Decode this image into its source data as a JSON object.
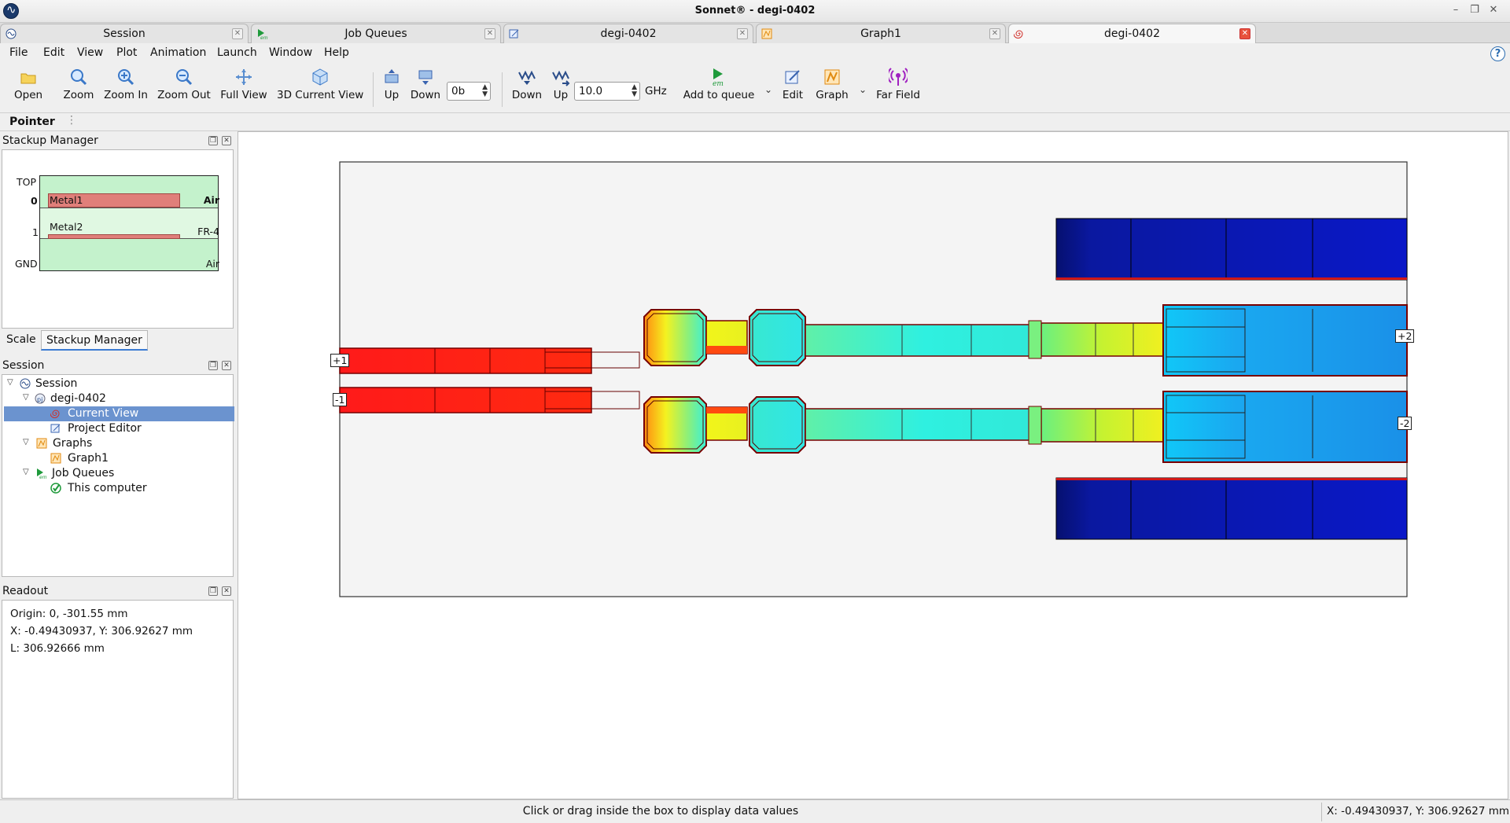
{
  "window": {
    "title": "Sonnet® - degi-0402"
  },
  "doc_tabs": [
    {
      "label": "Session",
      "icon": "sonnet-session-icon"
    },
    {
      "label": "Job Queues",
      "icon": "em-queue-icon"
    },
    {
      "label": "degi-0402",
      "icon": "project-editor-icon"
    },
    {
      "label": "Graph1",
      "icon": "graph-icon"
    },
    {
      "label": "degi-0402",
      "icon": "current-view-spiral-icon",
      "active": true
    }
  ],
  "menu": [
    "File",
    "Edit",
    "View",
    "Plot",
    "Animation",
    "Launch",
    "Window",
    "Help"
  ],
  "toolbar": {
    "open": "Open",
    "zoom": "Zoom",
    "zoom_in": "Zoom In",
    "zoom_out": "Zoom Out",
    "full_view": "Full View",
    "view_3d": "3D Current View",
    "level_up": "Up",
    "level_down": "Down",
    "level_value": "0b",
    "freq_down": "Down",
    "freq_up": "Up",
    "freq_value": "10.0",
    "freq_unit": "GHz",
    "add_to_queue": "Add to queue",
    "edit": "Edit",
    "graph": "Graph",
    "far_field": "Far Field"
  },
  "mode": {
    "label": "Pointer"
  },
  "stackup": {
    "title": "Stackup Manager",
    "labels": {
      "top": "TOP",
      "level0": "0",
      "level1": "1",
      "gnd": "GND"
    },
    "metals": [
      "Metal1",
      "Metal2"
    ],
    "dielectrics": [
      "Air",
      "FR-4",
      "Air"
    ]
  },
  "scale_tabs": [
    "Scale",
    "Stackup Manager"
  ],
  "session": {
    "title": "Session",
    "tree": [
      {
        "label": "Session",
        "icon": "sonnet-session-icon",
        "level": 0,
        "expanded": true
      },
      {
        "label": "degi-0402",
        "icon": "project-icon",
        "level": 1,
        "expanded": true
      },
      {
        "label": "Current View",
        "icon": "current-view-spiral-icon",
        "level": 2,
        "selected": true
      },
      {
        "label": "Project Editor",
        "icon": "project-editor-icon",
        "level": 2
      },
      {
        "label": "Graphs",
        "icon": "graph-icon",
        "level": 1,
        "expanded": true
      },
      {
        "label": "Graph1",
        "icon": "graph-icon",
        "level": 2
      },
      {
        "label": "Job Queues",
        "icon": "em-queue-icon",
        "level": 1,
        "expanded": true
      },
      {
        "label": "This computer",
        "icon": "checkmark-icon",
        "level": 2
      }
    ]
  },
  "readout": {
    "title": "Readout",
    "origin": "Origin: 0, -301.55 mm",
    "xy": "X: -0.49430937, Y: 306.92627 mm",
    "length": "L: 306.92666 mm"
  },
  "ports": [
    "+1",
    "-1",
    "+2",
    "-2"
  ],
  "status": {
    "message": "Click or drag inside the box to display data values",
    "coords": "X: -0.49430937, Y: 306.92627 mm"
  },
  "colors": {
    "metal_red": "#ff1a1a",
    "hot_yellow": "#f2f520",
    "mid_cyan": "#2ff0e8",
    "mid_green": "#7af08a",
    "cold_blue": "#1a8cf0",
    "dark_blue": "#0a1aa8",
    "outline": "#8a0000"
  }
}
